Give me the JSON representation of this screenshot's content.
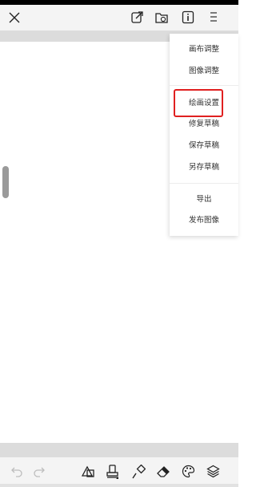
{
  "toolbar": {
    "close_icon": "close-icon",
    "share_icon": "share-edit-icon",
    "folder_icon": "folder-sync-icon",
    "info_icon": "info-icon",
    "menu_icon": "menu-icon"
  },
  "menu": {
    "items": [
      {
        "label": "画布调整"
      },
      {
        "label": "图像调整"
      },
      {
        "label": "绘画设置"
      },
      {
        "label": "修复草稿"
      },
      {
        "label": "保存草稿"
      },
      {
        "label": "另存草稿"
      },
      {
        "label": "导出"
      },
      {
        "label": "发布图像"
      }
    ],
    "highlighted_item": "绘画设置",
    "highlight_color": "#e02020"
  },
  "bottom_toolbar": {
    "icons": [
      "undo-icon",
      "redo-icon",
      "shape-icon",
      "stamp-icon",
      "brush-icon",
      "eraser-icon",
      "palette-icon",
      "layers-icon"
    ]
  }
}
